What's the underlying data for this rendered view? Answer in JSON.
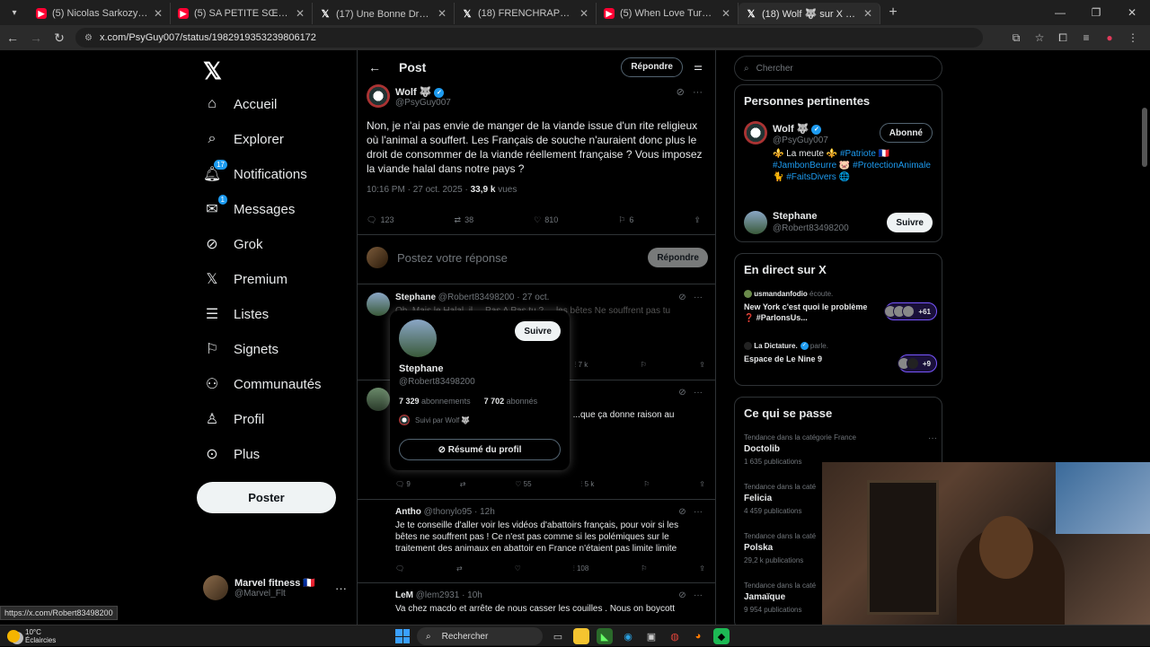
{
  "browser": {
    "tabs": [
      {
        "title": "(5) Nicolas Sarkozy condamné...",
        "favicon": "youtube-icon"
      },
      {
        "title": "(5) SA PETITE SŒUR DISPARAÎT",
        "favicon": "youtube-icon"
      },
      {
        "title": "(17) Une Bonne Droite 🥩 sur X",
        "favicon": "x-icon"
      },
      {
        "title": "(18) FRENCHRAPUS sur X : \"",
        "favicon": "x-icon"
      },
      {
        "title": "(5) When Love Turns Into Rival",
        "favicon": "youtube-icon"
      },
      {
        "title": "(18) Wolf 🐺 sur X : \"@RobertB",
        "favicon": "x-icon",
        "active": true
      }
    ],
    "url": "x.com/PsyGuy007/status/1982919353239806172",
    "status_url": "https://x.com/Robert83498200"
  },
  "sidebar": {
    "items": [
      {
        "label": "Accueil",
        "icon": "home-icon"
      },
      {
        "label": "Explorer",
        "icon": "search-icon"
      },
      {
        "label": "Notifications",
        "icon": "bell-icon",
        "badge": "17"
      },
      {
        "label": "Messages",
        "icon": "mail-icon",
        "badge": "1"
      },
      {
        "label": "Grok",
        "icon": "grok-icon"
      },
      {
        "label": "Premium",
        "icon": "x-icon"
      },
      {
        "label": "Listes",
        "icon": "list-icon"
      },
      {
        "label": "Signets",
        "icon": "bookmark-icon"
      },
      {
        "label": "Communautés",
        "icon": "people-icon"
      },
      {
        "label": "Profil",
        "icon": "person-icon"
      },
      {
        "label": "Plus",
        "icon": "more-circle-icon"
      }
    ],
    "post_button": "Poster",
    "account": {
      "name": "Marvel fitness 🇫🇷",
      "handle": "@Marvel_Flt"
    }
  },
  "main": {
    "header_title": "Post",
    "reply_pill": "Répondre",
    "op": {
      "name": "Wolf 🐺",
      "handle": "@PsyGuy007",
      "text": "Non, je n'ai pas envie de manger de la viande issue d'un rite religieux où l'animal a souffert. Les Français de souche n'auraient donc plus le droit de consommer de la viande réellement française ? Vous imposez la viande halal dans notre pays ?",
      "time": "10:16 PM · 27 oct. 2025 · ",
      "views": "33,9 k",
      "views_label": " vues",
      "stats": {
        "replies": "123",
        "reposts": "38",
        "likes": "810",
        "bookmarks": "6"
      }
    },
    "compose": {
      "placeholder": "Postez votre réponse",
      "button": "Répondre"
    },
    "replies": [
      {
        "name": "Stephane",
        "handle": "@Robert83498200",
        "time": "· 27 oct.",
        "text": "Oh, Mais le Halal, il ... Pas A Pas tu ? ... les bêtes Ne souffrent pas tu",
        "views": "7 k"
      },
      {
        "name": "",
        "handle": "",
        "time": "",
        "text": "...ert... ...sais que l'animal n'a pas souffert ... ...que ça donne raison au",
        "replies": "9",
        "likes": "55",
        "views": "5 k"
      },
      {
        "name": "Antho",
        "handle": "@thonylo95",
        "time": "· 12h",
        "text": "Je te conseille d'aller voir les vidéos d'abattoirs français, pour voir si les bêtes ne souffrent pas ! Ce n'est pas comme si les polémiques sur le traitement des animaux en abattoir en France n'étaient pas limite limite",
        "views": "108"
      },
      {
        "name": "LeM",
        "handle": "@lem2931",
        "time": "· 10h",
        "text": "Va chez macdo et arrête de nous casser les couilles . Nous on boycott"
      }
    ],
    "hovercard": {
      "name": "Stephane",
      "handle": "@Robert83498200",
      "following": "7 329",
      "following_label": " abonnements",
      "followers": "7 702",
      "followers_label": " abonnés",
      "followed_by": "Suivi par Wolf 🐺",
      "follow_button": "Suivre",
      "summary_button": "Résumé du profil"
    }
  },
  "right": {
    "search_placeholder": "Chercher",
    "relevant": {
      "title": "Personnes pertinentes",
      "people": [
        {
          "name": "Wolf 🐺",
          "handle": "@PsyGuy007",
          "button": "Abonné"
        },
        {
          "name": "Stephane",
          "handle": "@Robert83498200",
          "button": "Suivre"
        }
      ],
      "bio_parts": [
        "⚜️ La meute ⚜️ ",
        "#Patriote",
        " 🇫🇷 ",
        "#JambonBeurre",
        " 🐷 ",
        "#ProtectionAnimale",
        " 🐈 ",
        "#FaitsDivers",
        " 🌐"
      ]
    },
    "live": {
      "title": "En direct sur X",
      "items": [
        {
          "host": "usmandanfodio",
          "verb": " écoute.",
          "title": "New York c'est quoi le problème ❓ #ParlonsUs...",
          "count": "+61"
        },
        {
          "host": "La Dictature.",
          "verb": " parle.",
          "title": "Espace de Le Nine 9",
          "count": "+9"
        }
      ]
    },
    "trends": {
      "title": "Ce qui se passe",
      "items": [
        {
          "category": "Tendance dans la catégorie France",
          "name": "Doctolib",
          "count": "1 635 publications"
        },
        {
          "category": "Tendance dans la caté",
          "name": "Felicia",
          "count": "4 459 publications"
        },
        {
          "category": "Tendance dans la caté",
          "name": "Polska",
          "count": "29,2 k publications"
        },
        {
          "category": "Tendance dans la caté",
          "name": "Jamaïque",
          "count": "9 954 publications"
        }
      ]
    }
  },
  "taskbar": {
    "temp": "10°C",
    "weather": "Éclaircies",
    "search": "Rechercher"
  },
  "colors": {
    "accent": "#1d9bf0",
    "background": "#000000",
    "border": "#2f3336",
    "muted": "#71767b"
  }
}
